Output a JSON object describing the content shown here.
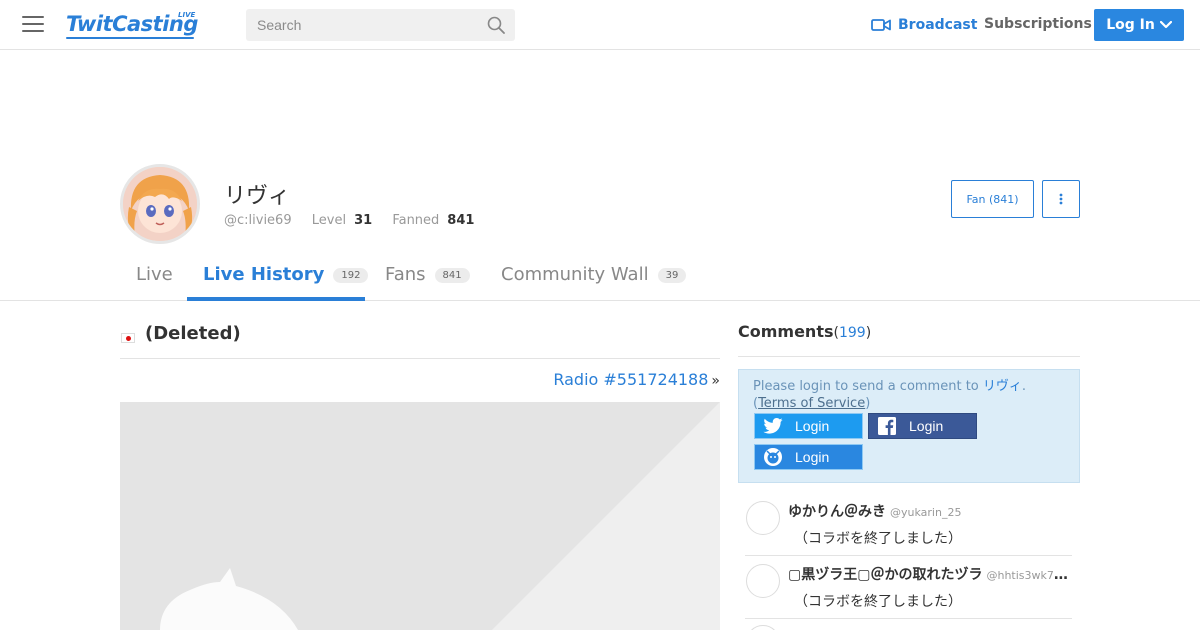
{
  "header": {
    "logo_text": "TwitCasting",
    "logo_live": "LIVE",
    "search_placeholder": "Search",
    "broadcast_label": "Broadcast",
    "subscriptions_label": "Subscriptions",
    "login_label": "Log In"
  },
  "profile": {
    "name": "リヴィ",
    "user_id": "@c:livie69",
    "level_label": "Level",
    "level_value": "31",
    "fanned_label": "Fanned",
    "fanned_value": "841",
    "fan_button_label": "Fan (841)"
  },
  "tabs": [
    {
      "label": "Live",
      "count": ""
    },
    {
      "label": "Live History",
      "count": "192"
    },
    {
      "label": "Fans",
      "count": "841"
    },
    {
      "label": "Community Wall",
      "count": "39"
    }
  ],
  "movie": {
    "title": "(Deleted)",
    "radio_link": "Radio #551724188",
    "radio_chevron": "»"
  },
  "comments": {
    "title": "Comments",
    "count": "199",
    "login_message_prefix": "Please login to send a comment to",
    "login_message_name": "リヴィ",
    "login_message_suffix": ".",
    "tos_label": "Terms of Service",
    "twitter_login": "Login",
    "facebook_login": "Login",
    "twitcasting_login": "Login",
    "items": [
      {
        "name": "ゆかりん＠みき",
        "handle": "@yukarin_25",
        "text": "（コラボを終了しました）"
      },
      {
        "name": "▢黒ヅラ王▢＠かの取れたヅラ",
        "handle": "@hhtis3wk7uh...",
        "text": "（コラボを終了しました）"
      }
    ]
  },
  "colors": {
    "accent": "#2a7fd7",
    "twitter": "#1d9bf0",
    "facebook": "#3b5998",
    "login_box_bg": "#dcedf8"
  }
}
